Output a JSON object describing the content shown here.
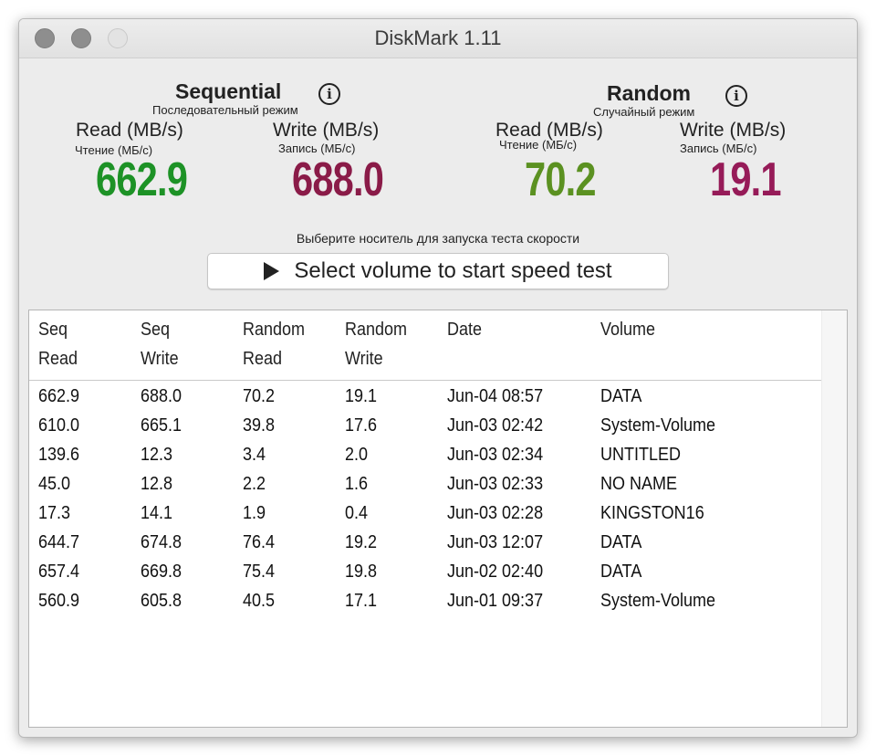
{
  "window": {
    "title": "DiskMark 1.11"
  },
  "sequential": {
    "title": "Sequential",
    "subtitle": "Последовательный режим",
    "read": {
      "label": "Read (MB/s)",
      "sublabel": "Чтение (МБ/с)",
      "value": "662.9"
    },
    "write": {
      "label": "Write (MB/s)",
      "sublabel": "Запись (МБ/с)",
      "value": "688.0"
    }
  },
  "random": {
    "title": "Random",
    "subtitle": "Случайный режим",
    "read": {
      "label": "Read (MB/s)",
      "sublabel": "Чтение (МБ/с)",
      "value": "70.2"
    },
    "write": {
      "label": "Write (MB/s)",
      "sublabel": "Запись (МБ/с)",
      "value": "19.1"
    }
  },
  "colors": {
    "seq_read": "#1d9226",
    "seq_write": "#8a1b48",
    "rand_read": "#5b9121",
    "rand_write": "#961b58"
  },
  "icons": {
    "info": "info-icon",
    "play": "play-icon"
  },
  "prompt": "Выберите носитель для запуска теста скорости",
  "start_button": {
    "label": "Select volume to start speed test"
  },
  "table": {
    "headers": [
      {
        "line1": "Seq",
        "line2": "Read"
      },
      {
        "line1": "Seq",
        "line2": "Write"
      },
      {
        "line1": "Random",
        "line2": "Read"
      },
      {
        "line1": "Random",
        "line2": "Write"
      },
      {
        "line1": "Date",
        "line2": ""
      },
      {
        "line1": "Volume",
        "line2": ""
      }
    ],
    "rows": [
      [
        "662.9",
        "688.0",
        "70.2",
        "19.1",
        "Jun-04 08:57",
        "DATA"
      ],
      [
        "610.0",
        "665.1",
        "39.8",
        "17.6",
        "Jun-03 02:42",
        "System-Volume"
      ],
      [
        "139.6",
        "12.3",
        "3.4",
        "2.0",
        "Jun-03 02:34",
        "UNTITLED"
      ],
      [
        "45.0",
        "12.8",
        "2.2",
        "1.6",
        "Jun-03 02:33",
        "NO NAME"
      ],
      [
        "17.3",
        "14.1",
        "1.9",
        "0.4",
        "Jun-03 02:28",
        "KINGSTON16"
      ],
      [
        "644.7",
        "674.8",
        "76.4",
        "19.2",
        "Jun-03 12:07",
        "DATA"
      ],
      [
        "657.4",
        "669.8",
        "75.4",
        "19.8",
        "Jun-02 02:40",
        "DATA"
      ],
      [
        "560.9",
        "605.8",
        "40.5",
        "17.1",
        "Jun-01 09:37",
        "System-Volume"
      ]
    ]
  }
}
